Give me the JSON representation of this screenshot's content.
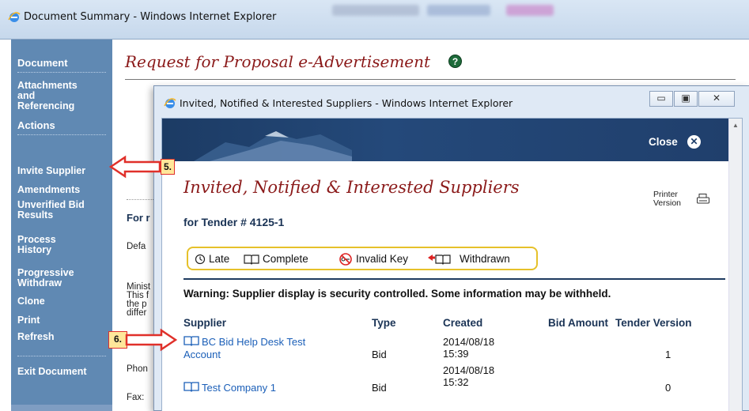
{
  "outer_window": {
    "title": "Document Summary - Windows Internet Explorer"
  },
  "sidebar": {
    "document_header": "Document",
    "attachments_lines": [
      "Attachments",
      "and",
      "Referencing"
    ],
    "actions_header": "Actions",
    "items": [
      {
        "label": "Invite Supplier"
      },
      {
        "label": "Amendments"
      },
      {
        "label": "Unverified Bid"
      },
      {
        "label": "Results"
      },
      {
        "label": "Process"
      },
      {
        "label": "History"
      },
      {
        "label": "Progressive"
      },
      {
        "label": "Withdraw"
      },
      {
        "label": "Clone"
      },
      {
        "label": "Print"
      },
      {
        "label": "Refresh"
      }
    ],
    "exit_label": "Exit Document"
  },
  "main": {
    "heading": "Request for Proposal e-Advertisement",
    "fragments": [
      "For r",
      "Defa",
      "Minist",
      "This f",
      "the p",
      "differ",
      "Phon",
      "Fax:"
    ]
  },
  "popup": {
    "title": "Invited, Notified & Interested Suppliers - Windows Internet Explorer",
    "close_label": "Close",
    "heading": "Invited, Notified & Interested Suppliers",
    "printer_line1": "Printer",
    "printer_line2": "Version",
    "tender_line": "for Tender # 4125-1",
    "legend": {
      "late": "Late",
      "complete": "Complete",
      "invalid": "Invalid Key",
      "withdrawn": "Withdrawn"
    },
    "warning": "Warning: Supplier display is security controlled. Some information may be withheld.",
    "columns": [
      "Supplier",
      "Type",
      "Created",
      "Bid Amount",
      "Tender Version"
    ],
    "rows": [
      {
        "supplier_line1": "BC Bid Help Desk Test",
        "supplier_line2": "Account",
        "type": "Bid",
        "created_date": "2014/08/18",
        "created_time": "15:39",
        "version": "1"
      },
      {
        "supplier_line1": "Test Company 1",
        "type": "Bid",
        "created_date": "2014/08/18",
        "created_time": "15:32",
        "version": "0"
      }
    ]
  },
  "callouts": {
    "step5": "5.",
    "step6": "6."
  },
  "colors": {
    "sidebar": "#6089b3",
    "heading_red": "#8b1a1a",
    "banner_navy": "#1f3f6a",
    "link_blue": "#1b5fb8",
    "callout_fill": "#ffe79a",
    "callout_border": "#e0302a",
    "legend_border": "#e6c12a"
  }
}
